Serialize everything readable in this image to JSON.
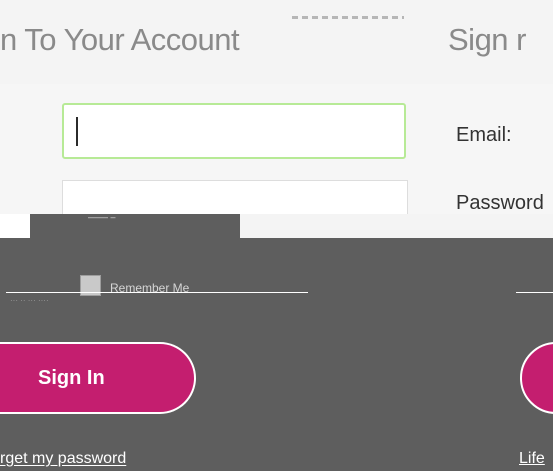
{
  "header": {
    "title": "n To Your Account",
    "right_title": "Sign  r"
  },
  "form": {
    "email_label": "Email:",
    "password_label": "Password",
    "remember_label": "Remember Me",
    "signin_label": "Sign In",
    "forgot_label": "rget my password",
    "right_link_label": "Life"
  },
  "colors": {
    "brand": "#c41e6f",
    "overlay": "#5e5e5e",
    "focus_border": "#b7ea96"
  }
}
